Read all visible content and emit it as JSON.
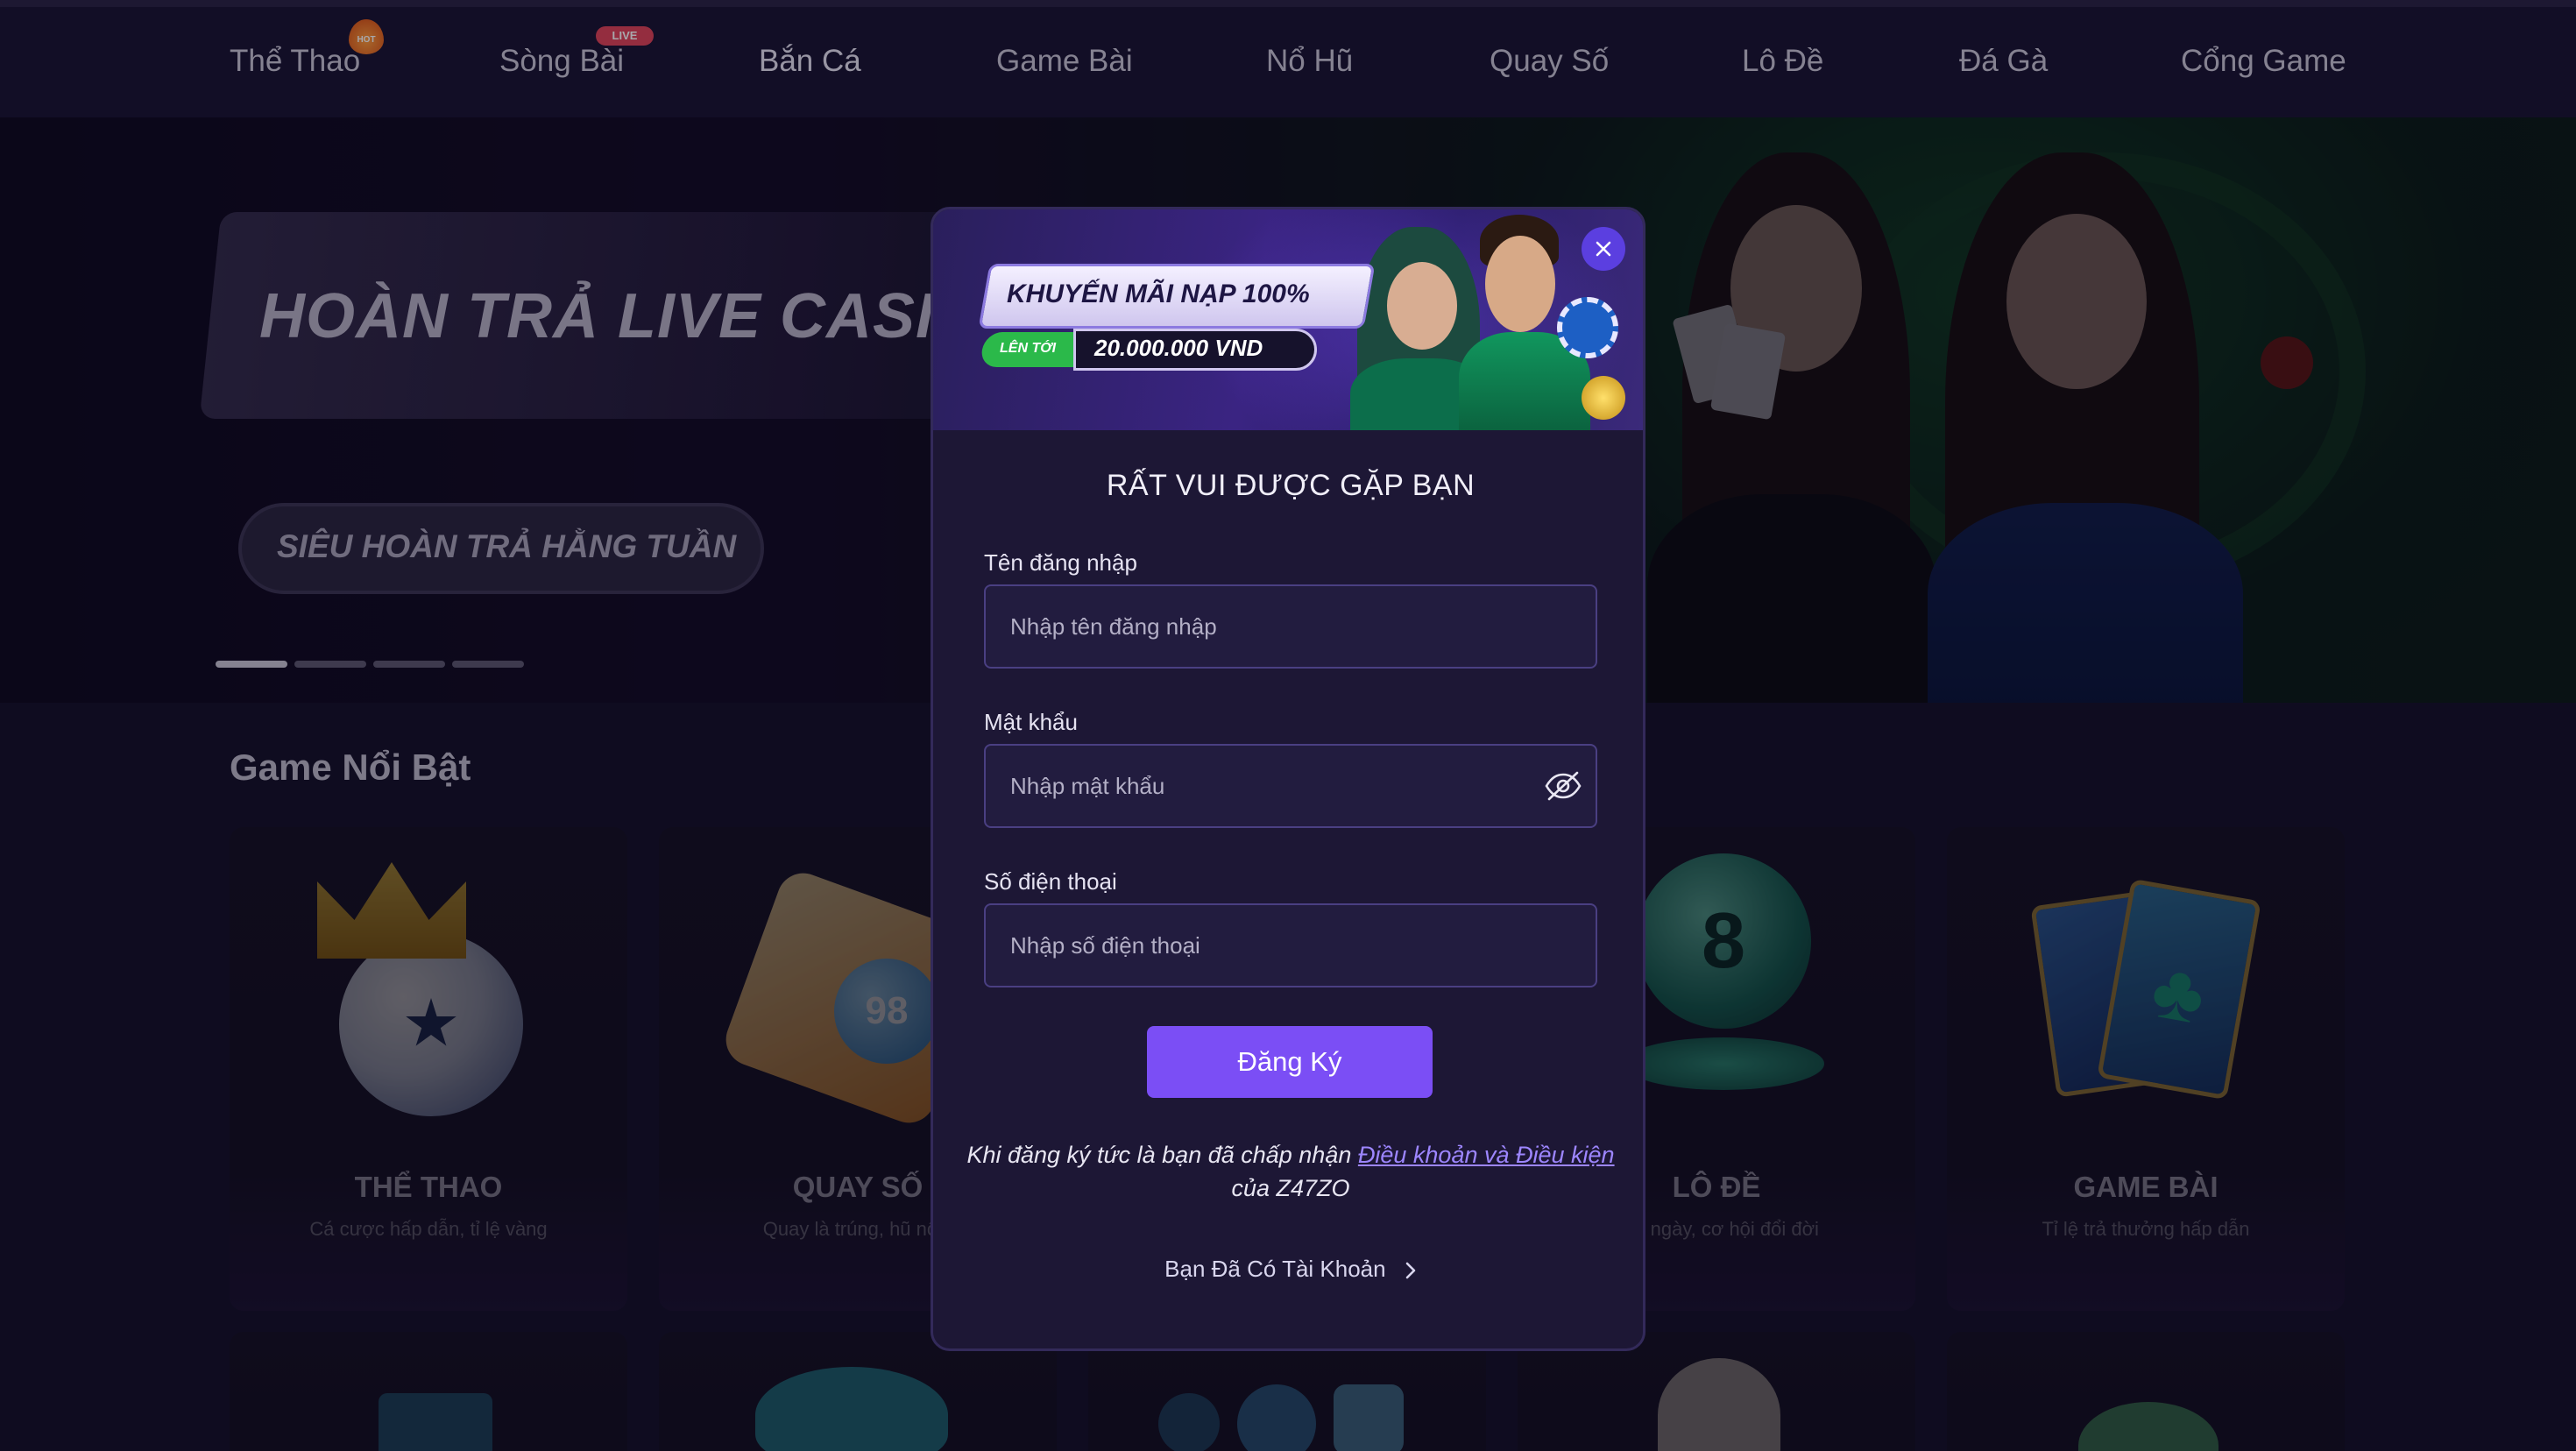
{
  "nav": {
    "items": [
      {
        "label": "Thể Thao"
      },
      {
        "label": "Sòng Bài"
      },
      {
        "label": "Bắn Cá"
      },
      {
        "label": "Game Bài"
      },
      {
        "label": "Nổ Hũ"
      },
      {
        "label": "Quay Số"
      },
      {
        "label": "Lô Đề"
      },
      {
        "label": "Đá Gà"
      },
      {
        "label": "Cổng Game"
      }
    ],
    "active": "Bắn Cá",
    "badge_hot": "HOT",
    "badge_live": "LIVE"
  },
  "hero": {
    "title": "HOÀN TRẢ LIVE CASI",
    "subtitle": "SIÊU HOÀN TRẢ HẰNG TUẦN",
    "slides_total": 4,
    "slide_active": 1
  },
  "games": {
    "section_title": "Game Nổi Bật",
    "cards": [
      {
        "name": "THỂ THAO",
        "desc": "Cá cược hấp dẫn, tỉ lệ vàng",
        "icon": "football-crown-icon"
      },
      {
        "name": "QUAY SỐ",
        "desc": "Quay là trúng, hũ nổ s",
        "icon": "lottery-ball-icon"
      },
      {
        "name": "LÔ ĐỀ",
        "desc": "mỗi ngày, cơ hội đổi đời",
        "icon": "eight-ball-icon"
      },
      {
        "name": "GAME BÀI",
        "desc": "Tỉ lệ trả thưởng hấp dẫn",
        "icon": "playing-cards-icon"
      }
    ]
  },
  "modal": {
    "promo": {
      "title": "KHUYẾN MÃI NẠP 100%",
      "tag": "LÊN TỚI",
      "amount": "20.000.000 VND"
    },
    "title": "RẤT VUI ĐƯỢC GẶP BẠN",
    "fields": {
      "username": {
        "label": "Tên đăng nhập",
        "placeholder": "Nhập tên đăng nhập",
        "value": ""
      },
      "password": {
        "label": "Mật khẩu",
        "placeholder": "Nhập mật khẩu",
        "value": ""
      },
      "phone": {
        "label": "Số điện thoại",
        "placeholder": "Nhập số điện thoại",
        "value": ""
      }
    },
    "submit_label": "Đăng Ký",
    "terms": {
      "prefix": "Khi đăng ký tức là bạn đã chấp nhận ",
      "link": "Điều khoản và Điều kiện",
      "suffix": "của Z47ZO"
    },
    "login_link": "Bạn Đã Có Tài Khoản"
  },
  "colors": {
    "accent": "#7b4ef5",
    "nav_underline": "#8f7bff",
    "background": "#15112a",
    "modal_bg": "#1d1735"
  }
}
